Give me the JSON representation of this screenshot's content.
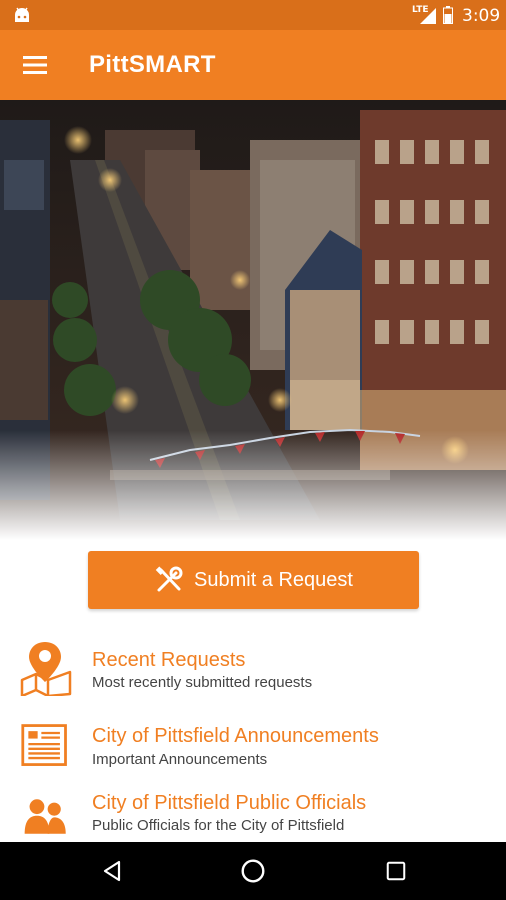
{
  "status_bar": {
    "network": "LTE",
    "time": "3:09",
    "icons": [
      "android-icon",
      "signal-icon",
      "battery-icon"
    ]
  },
  "app_bar": {
    "title": "PittSMART",
    "menu_icon": "hamburger-menu-icon"
  },
  "hero": {
    "icon": "downtown-street-night-photo"
  },
  "submit_button": {
    "label": "Submit a Request",
    "icon": "wrench-screwdriver-icon"
  },
  "menu_items": [
    {
      "title": "Recent Requests",
      "subtitle": "Most recently submitted requests",
      "icon": "map-pin-icon"
    },
    {
      "title": "City of Pittsfield Announcements",
      "subtitle": "Important Announcements",
      "icon": "newspaper-icon"
    },
    {
      "title": "City of Pittsfield Public Officials",
      "subtitle": "Public Officials for the City of Pittsfield",
      "icon": "people-icon"
    }
  ],
  "nav_bar": {
    "buttons": [
      "back-icon",
      "home-icon",
      "recents-icon"
    ]
  },
  "colors": {
    "status_bar": "#d96f1a",
    "accent": "#f07f22",
    "subtitle_text": "#444444",
    "nav_bar": "#000000"
  }
}
